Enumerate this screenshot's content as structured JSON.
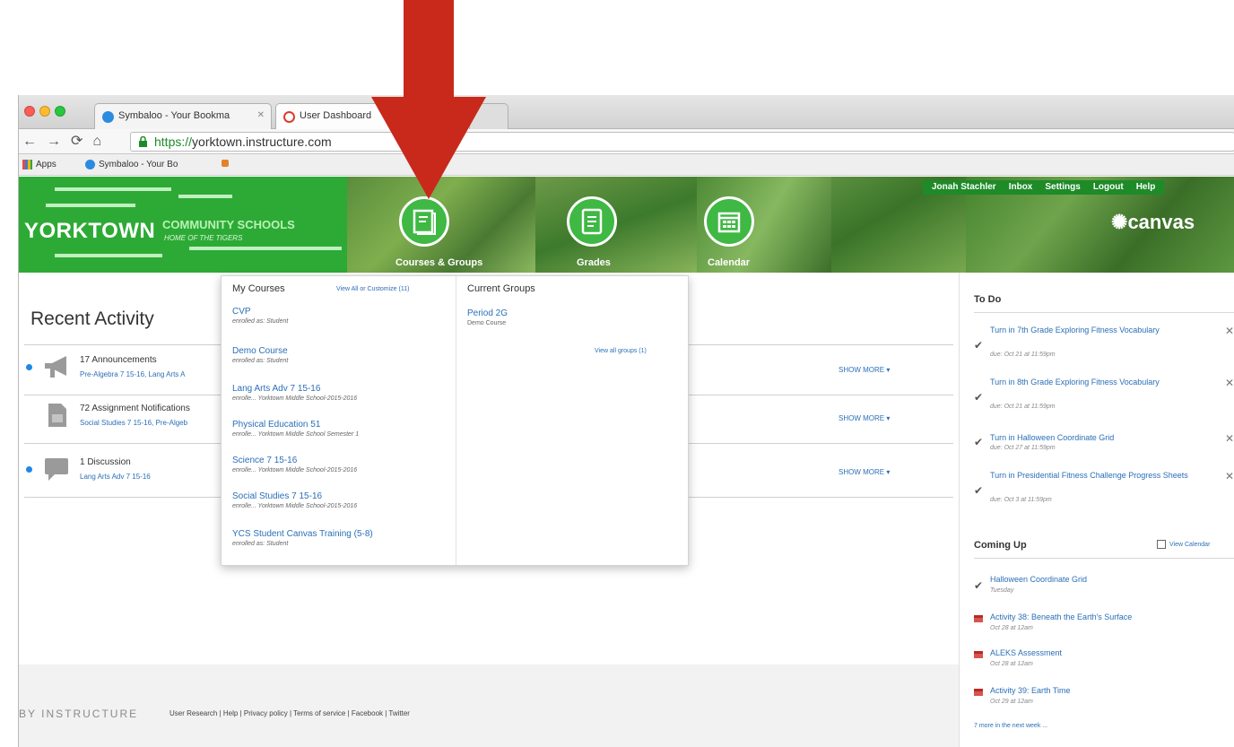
{
  "annotation": {
    "arrow_color": "#c8291a"
  },
  "browser": {
    "tabs": [
      {
        "label": "Symbaloo - Your Bookma",
        "active": false
      },
      {
        "label": "User Dashboard",
        "active": true
      }
    ],
    "url": {
      "scheme": "https://",
      "host": "yorktown.instructure.com"
    },
    "bookmarks": [
      "Apps",
      "Symbaloo - Your Bo"
    ]
  },
  "header": {
    "logo": {
      "name": "YORKTOWN",
      "subtitle": "COMMUNITY SCHOOLS",
      "tagline": "HOME OF THE TIGERS"
    },
    "nav": [
      {
        "label": "Courses & Groups",
        "icon": "courses-icon"
      },
      {
        "label": "Grades",
        "icon": "grades-icon"
      },
      {
        "label": "Calendar",
        "icon": "calendar-icon"
      }
    ],
    "user_menu": [
      "Jonah Stachler",
      "Inbox",
      "Settings",
      "Logout",
      "Help"
    ],
    "brand": "canvas",
    "colors": {
      "green": "#2f9e3a",
      "accent": "#3fb844"
    }
  },
  "recent_activity": {
    "title": "Recent Activity",
    "items": [
      {
        "count_title": "17 Announcements",
        "sub": "Pre-Algebra 7 15-16, Lang Arts A",
        "more": "SHOW MORE",
        "unread": true
      },
      {
        "count_title": "72 Assignment Notifications",
        "sub": "Social Studies 7 15-16, Pre-Algeb",
        "more": "SHOW MORE",
        "unread": false
      },
      {
        "count_title": "1 Discussion",
        "sub": "Lang Arts Adv 7 15-16",
        "more": "SHOW MORE",
        "unread": true
      }
    ]
  },
  "dropdown": {
    "courses_heading": "My Courses",
    "courses_link": "View All or Customize (11)",
    "courses": [
      {
        "name": "CVP",
        "enrollment": "enrolled as: Student"
      },
      {
        "name": "Demo Course",
        "enrollment": "enrolled as: Student"
      },
      {
        "name": "Lang Arts Adv 7 15-16",
        "enrollment": "enrolle... Yorktown Middle School-2015-2016"
      },
      {
        "name": "Physical Education 51",
        "enrollment": "enrolle... Yorktown Middle School Semester 1"
      },
      {
        "name": "Science 7 15-16",
        "enrollment": "enrolle... Yorktown Middle School-2015-2016"
      },
      {
        "name": "Social Studies 7 15-16",
        "enrollment": "enrolle... Yorktown Middle School-2015-2016"
      },
      {
        "name": "YCS Student Canvas Training (5-8)",
        "enrollment": "enrolled as: Student"
      }
    ],
    "groups_heading": "Current Groups",
    "groups": [
      {
        "name": "Period 2G",
        "course": "Demo Course"
      }
    ],
    "groups_link": "View all groups (1)"
  },
  "todo": {
    "heading": "To Do",
    "items": [
      {
        "title": "Turn in 7th Grade Exploring Fitness Vocabulary",
        "due": "due: Oct 21 at 11:59pm"
      },
      {
        "title": "Turn in 8th Grade Exploring Fitness Vocabulary",
        "due": "due: Oct 21 at 11:59pm"
      },
      {
        "title": "Turn in Halloween Coordinate Grid",
        "due": "due: Oct 27 at 11:59pm"
      },
      {
        "title": "Turn in Presidential Fitness Challenge Progress Sheets",
        "due": "due: Oct 3 at 11:59pm"
      }
    ]
  },
  "coming_up": {
    "heading": "Coming Up",
    "calendar_link": "View Calendar",
    "items": [
      {
        "title": "Halloween Coordinate Grid",
        "when": "Tuesday",
        "kind": "assignment"
      },
      {
        "title": "Activity 38: Beneath the Earth's Surface",
        "when": "Oct 28 at 12am",
        "kind": "event"
      },
      {
        "title": "ALEKS Assessment",
        "when": "Oct 28 at 12am",
        "kind": "event"
      },
      {
        "title": "Activity 39: Earth Time",
        "when": "Oct 29 at 12am",
        "kind": "event"
      }
    ],
    "more_link": "7 more in the next week ..."
  },
  "footer": {
    "brand": "BY INSTRUCTURE",
    "links": "User Research | Help | Privacy policy | Terms of service | Facebook | Twitter"
  }
}
